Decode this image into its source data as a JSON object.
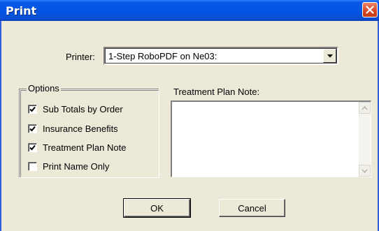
{
  "window": {
    "title": "Print"
  },
  "printer": {
    "label": "Printer:",
    "value": "1-Step RoboPDF on Ne03:"
  },
  "options": {
    "legend": "Options",
    "items": [
      {
        "label": "Sub Totals by Order",
        "checked": true
      },
      {
        "label": "Insurance Benefits",
        "checked": true
      },
      {
        "label": "Treatment Plan Note",
        "checked": true
      },
      {
        "label": "Print Name Only",
        "checked": false
      }
    ]
  },
  "note": {
    "label": "Treatment Plan Note:",
    "value": ""
  },
  "buttons": {
    "ok": "OK",
    "cancel": "Cancel"
  },
  "colors": {
    "titlebar": "#0355e3",
    "close": "#d94a25",
    "dialog_bg": "#ece9d8"
  }
}
